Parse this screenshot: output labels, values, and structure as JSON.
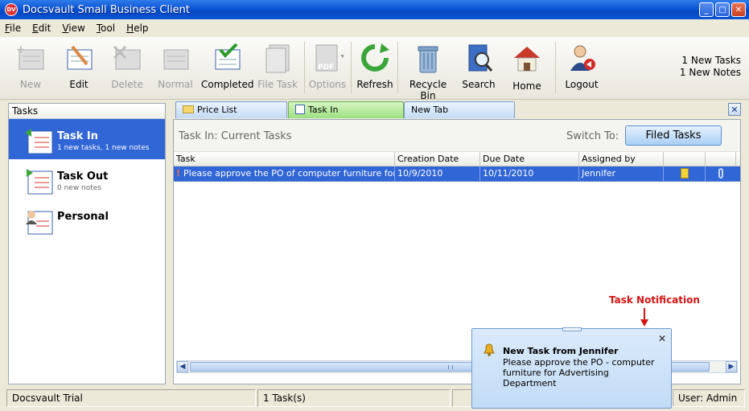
{
  "window": {
    "title": "Docsvault Small Business Client",
    "logo_text": "DV"
  },
  "menu": [
    {
      "key": "F",
      "rest": "ile"
    },
    {
      "key": "E",
      "rest": "dit"
    },
    {
      "key": "V",
      "rest": "iew"
    },
    {
      "key": "T",
      "rest": "ool"
    },
    {
      "key": "H",
      "rest": "elp"
    }
  ],
  "toolbar": {
    "new": "New",
    "edit": "Edit",
    "delete": "Delete",
    "normal": "Normal",
    "completed": "Completed",
    "file_task": "File Task",
    "options": "Options",
    "refresh": "Refresh",
    "recycle_bin": "Recycle Bin",
    "search": "Search",
    "home": "Home",
    "logout": "Logout",
    "status_tasks": "1 New Tasks",
    "status_notes": "1 New Notes"
  },
  "sidebar": {
    "header": "Tasks",
    "folders": [
      {
        "name": "Task In",
        "sub": "1 new tasks, 1 new notes"
      },
      {
        "name": "Task Out",
        "sub": "0 new notes"
      },
      {
        "name": "Personal",
        "sub": ""
      }
    ]
  },
  "tabs": [
    {
      "label": "Price List"
    },
    {
      "label": "Task In"
    },
    {
      "label": "New Tab"
    }
  ],
  "main": {
    "title": "Task In: Current Tasks",
    "switch_label": "Switch To:",
    "filed_button": "Filed Tasks",
    "columns": [
      "Task",
      "Creation Date",
      "Due Date",
      "Assigned by",
      "",
      ""
    ],
    "rows": [
      {
        "task": "Please approve the PO of computer furniture for...",
        "created": "10/9/2010",
        "due": "10/11/2010",
        "assigned": "Jennifer"
      }
    ]
  },
  "statusbar": {
    "product": "Docsvault Trial",
    "count": "1 Task(s)",
    "user": "User: Admin"
  },
  "notification": {
    "callout": "Task Notification",
    "title": "New Task from Jennifer",
    "body": "Please approve the PO - computer furniture for Advertising Department"
  }
}
